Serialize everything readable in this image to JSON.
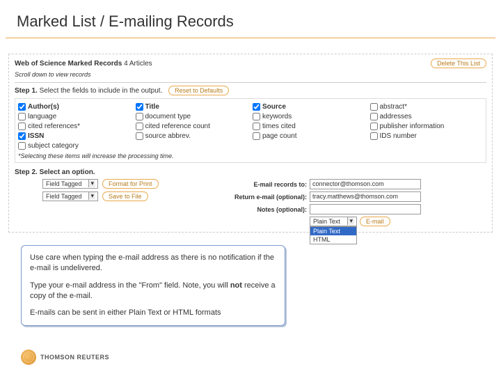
{
  "slide": {
    "title": "Marked List / E-mailing Records"
  },
  "panel": {
    "header_title": "Web of Science Marked Records",
    "header_count": "4 Articles",
    "delete_btn": "Delete This List",
    "scroll_hint": "Scroll down to view records",
    "step1_label": "Step 1. ",
    "step1_text": "Select the fields to include in the output.",
    "reset_btn": "Reset to Defaults",
    "fields": {
      "authors": "Author(s)",
      "title": "Title",
      "source": "Source",
      "abstract": "abstract*",
      "language": "language",
      "doctype": "document type",
      "keywords": "keywords",
      "addresses": "addresses",
      "citedrefs": "cited references*",
      "citedrefcount": "cited reference count",
      "timescited": "times cited",
      "pubinfo": "publisher information",
      "issn": "ISSN",
      "sourceabbrev": "source abbrev.",
      "pagecount": "page count",
      "idsnum": "IDS number",
      "subjcat": "subject category"
    },
    "footnote": "*Selecting these items will increase the processing time.",
    "step2_label": "Step 2. Select an option.",
    "select_val": "Field Tagged",
    "format_print_btn": "Format for Print",
    "save_file_btn": "Save to File",
    "email_to_label": "E-mail records to:",
    "email_to_value": "connector@thomson.com",
    "return_email_label": "Return e-mail (optional):",
    "return_email_value": "tracy.matthews@thomson.com",
    "notes_label": "Notes (optional):",
    "plaintext_sel": "Plain Text",
    "email_btn": "E-mail",
    "dropdown_opt1": "Plain Text",
    "dropdown_opt2": "HTML"
  },
  "callout": {
    "p1": "Use care when typing the e-mail address as there is no notification if the e-mail is undelivered.",
    "p2a": "Type your e-mail address in the \"From\" field. Note, you will ",
    "p2b": "not",
    "p2c": " receive a copy of the e-mail.",
    "p3": "E-mails can be sent in either Plain Text or HTML formats"
  },
  "footer": {
    "brand": "THOMSON REUTERS"
  }
}
